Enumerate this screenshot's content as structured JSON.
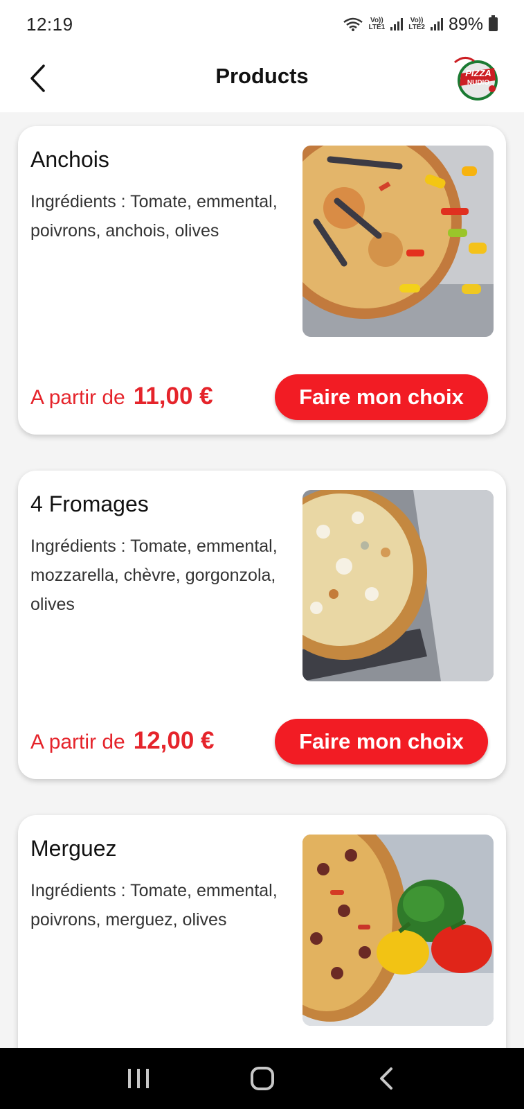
{
  "status_bar": {
    "time": "12:19",
    "net1": "Vo))\nLTE1",
    "net2": "Vo))\nLTE2",
    "battery": "89%",
    "icons": [
      "wifi-icon",
      "signal-icon",
      "signal-icon",
      "battery-icon"
    ]
  },
  "header": {
    "title": "Products",
    "back_icon": "chevron-left-icon",
    "logo_text_top": "PIZZA",
    "logo_text_bottom": "NUDIO"
  },
  "products": [
    {
      "name": "Anchois",
      "ingredients": "Ingrédients : Tomate, emmental, poivrons, anchois, olives",
      "price_prefix": "A partir de",
      "price": "11,00 €",
      "button": "Faire mon choix"
    },
    {
      "name": "4 Fromages",
      "ingredients": "Ingrédients : Tomate, emmental, mozzarella, chèvre, gorgonzola, olives",
      "price_prefix": "A partir de",
      "price": "12,00 €",
      "button": "Faire mon choix"
    },
    {
      "name": "Merguez",
      "ingredients": "Ingrédients : Tomate, emmental, poivrons, merguez, olives",
      "price_prefix": "A partir de",
      "price": "",
      "button": ""
    }
  ],
  "nav": {
    "recents_icon": "recents-icon",
    "home_icon": "home-icon",
    "back_icon": "back-icon"
  },
  "colors": {
    "accent": "#f21c24",
    "price": "#e5242b",
    "background": "#f4f4f4"
  }
}
